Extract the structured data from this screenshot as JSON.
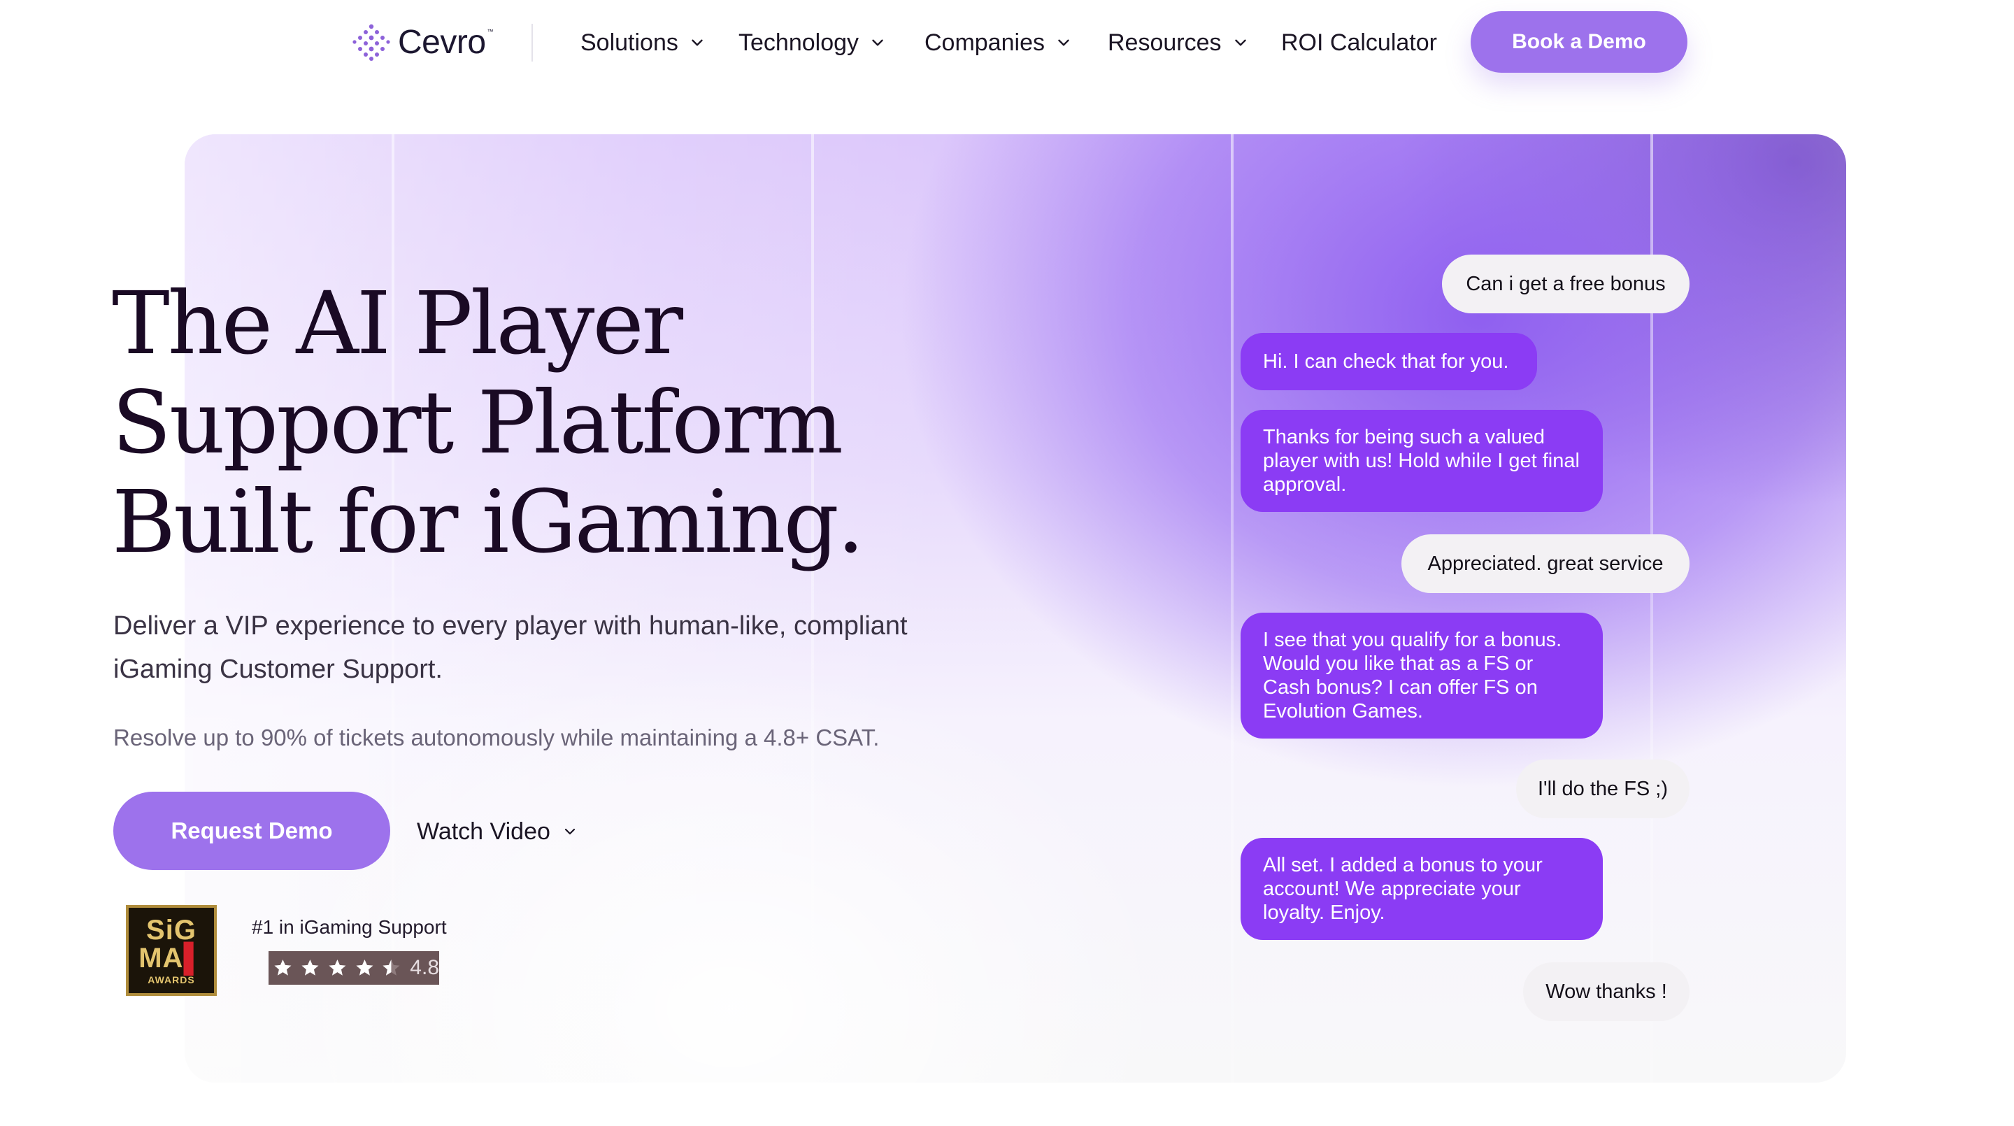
{
  "nav": {
    "logo_text": "Cevro",
    "logo_tm": "™",
    "items": [
      {
        "label": "Solutions",
        "has_dropdown": true
      },
      {
        "label": "Technology",
        "has_dropdown": true
      },
      {
        "label": "Companies",
        "has_dropdown": true
      },
      {
        "label": "Resources",
        "has_dropdown": true
      },
      {
        "label": "ROI Calculator",
        "has_dropdown": false
      }
    ],
    "cta_label": "Book a Demo"
  },
  "hero": {
    "headline_lines": [
      "The AI Player",
      "Support Platform",
      "Built for iGaming."
    ],
    "subtitle": "Deliver a VIP experience to every player with human-like, compliant iGaming Customer Support.",
    "stat_line": "Resolve up to 90% of tickets autonomously while maintaining a 4.8+ CSAT.",
    "primary_cta": "Request Demo",
    "secondary_cta": "Watch Video"
  },
  "award": {
    "logo_line1": "SiG",
    "logo_line2": "MA",
    "logo_line3": "AWARDS",
    "text": "#1 in iGaming Support",
    "rating": "4.8",
    "rating_stars": 4.5
  },
  "chat": {
    "messages": [
      {
        "from": "user",
        "text": "Can i get a free bonus"
      },
      {
        "from": "bot",
        "text": "Hi. I can check that for you."
      },
      {
        "from": "bot",
        "text": "Thanks for being such a valued player with us! Hold while I get final approval."
      },
      {
        "from": "user",
        "text": "Appreciated. great service"
      },
      {
        "from": "bot",
        "text": "I see that you qualify for a bonus. Would you like that as a FS or Cash bonus? I can offer FS on Evolution Games."
      },
      {
        "from": "user",
        "text": "I'll do the FS ;)"
      },
      {
        "from": "bot",
        "text": "All set. I added a bonus to your account! We appreciate your loyalty. Enjoy."
      },
      {
        "from": "user",
        "text": "Wow thanks !"
      }
    ]
  },
  "colors": {
    "accent": "#9d72ec",
    "bot_bubble": "#8b3cf4",
    "user_bubble": "#f3f1f4",
    "headline": "#1a0a24"
  }
}
